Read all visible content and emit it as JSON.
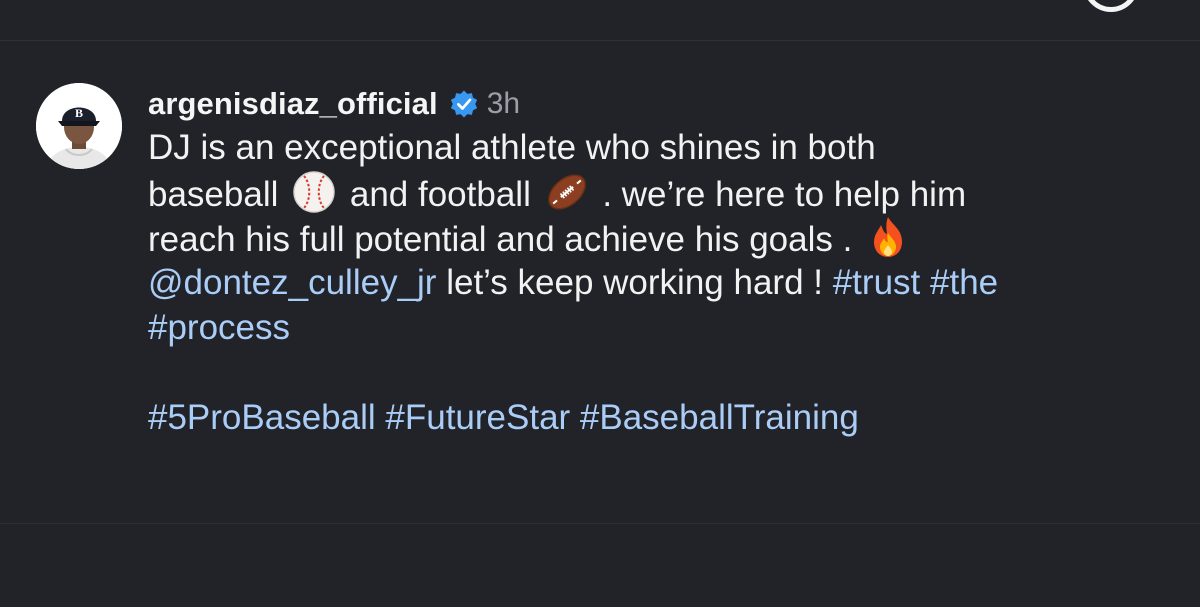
{
  "post": {
    "username": "argenisdiaz_official",
    "timestamp": "3h",
    "verified_icon": "verified-badge-icon",
    "avatar_icon": "profile-photo-boston-cap",
    "caption": {
      "line1": "DJ  is an exceptional athlete who shines in both",
      "line2_a": "baseball",
      "line2_b": "and football",
      "line2_c": ".  we’re here to help him",
      "line3": "reach his full potential and achieve his goals .",
      "mention": "@dontez_culley_jr",
      "line4_text": "let’s keep working hard !",
      "hashtag_trust": "#trust",
      "hashtag_the": "#the",
      "hashtag_process": "#process",
      "hashtags_bottom": "#5ProBaseball #FutureStar #BaseballTraining"
    },
    "emojis": [
      "baseball",
      "american-football",
      "fire"
    ]
  },
  "colors": {
    "background": "#212328",
    "text": "#f2f2f2",
    "link": "#aacdf7",
    "muted": "#9a9ea6",
    "verified": "#3897f0"
  }
}
